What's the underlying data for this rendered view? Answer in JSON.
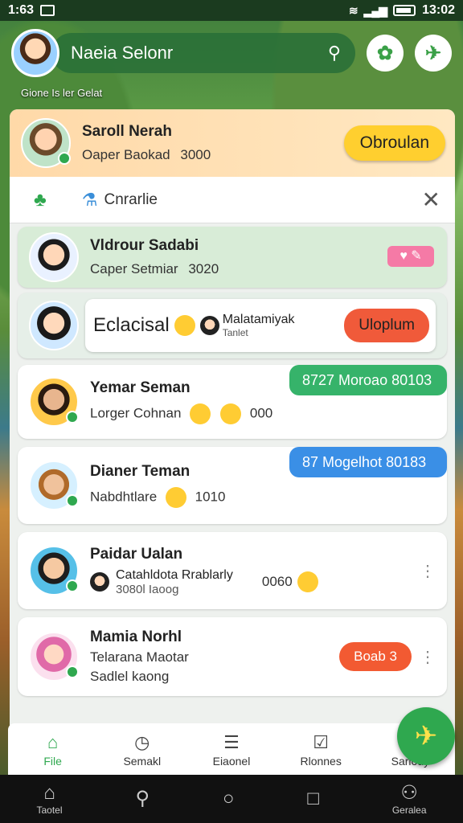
{
  "status": {
    "time": "1:63",
    "clock": "13:02"
  },
  "appbar": {
    "title": "Naeia Selonr",
    "mic_icon": "mic-icon",
    "subtitle": "Gione Is ler Gelat"
  },
  "header_card": {
    "name": "Saroll Nerah",
    "sub": "Oaper Baokad",
    "amount": "3000",
    "button": "Obroulan"
  },
  "toolbar": {
    "label": "Cnrarlie"
  },
  "rows": [
    {
      "name": "Vldrour Sadabi",
      "sub": "Caper Setmiar",
      "amount": "3020"
    },
    {
      "title": "Eclacisal",
      "stack_1": "Malatamiyak",
      "stack_2": "Tanlet",
      "button": "Uloplum"
    },
    {
      "name": "Yemar Seman",
      "sub": "Lorger Cohnan",
      "count": "000",
      "bubble": "8727 Moroao 80103"
    },
    {
      "name": "Dianer Teman",
      "sub": "Nabdhtlare",
      "count": "1010",
      "bubble": "87 Mogelhot 80183"
    },
    {
      "name": "Paidar Ualan",
      "line_1": "Catahldota Rrablarly",
      "line_2": "3080l Iaoog",
      "count": "0060"
    },
    {
      "name": "Mamia Norhl",
      "line_1": "Telarana Maotar",
      "line_2": "Sadlel kaong",
      "badge": "Boab 3"
    }
  ],
  "nav": [
    "File",
    "Semakl",
    "Eiaonel",
    "Rlonnes",
    "Sarlody"
  ],
  "sysnav": {
    "left": "Taotel",
    "right": "Geralea"
  }
}
